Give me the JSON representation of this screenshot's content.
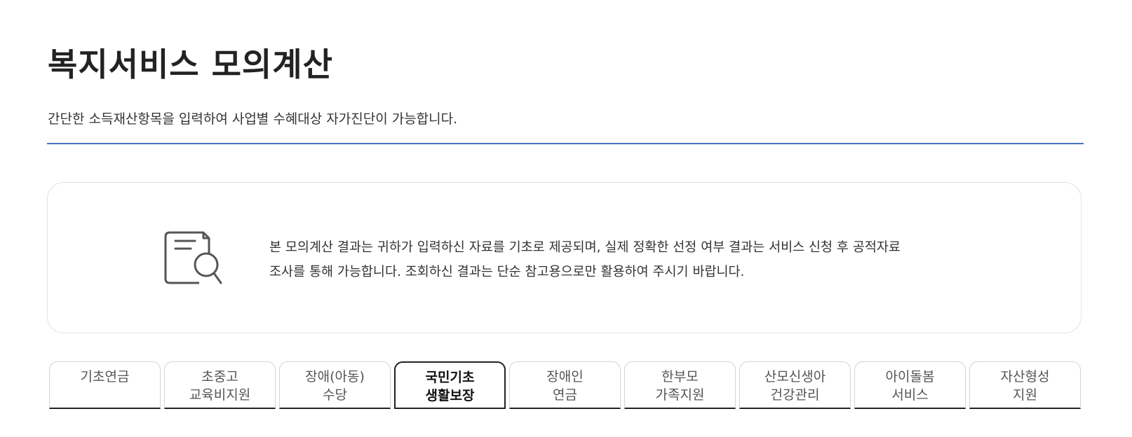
{
  "header": {
    "title": "복지서비스 모의계산",
    "description": "간단한 소득재산항목을 입력하여 사업별 수혜대상 자가진단이 가능합니다."
  },
  "notice": {
    "icon": "document-search-icon",
    "line1": "본 모의계산 결과는 귀하가 입력하신 자료를 기초로 제공되며, 실제 정확한 선정 여부 결과는 서비스 신청 후 공적자료",
    "line2": "조사를 통해 가능합니다. 조회하신 결과는 단순 참고용으로만 활용하여 주시기 바랍니다."
  },
  "colors": {
    "divider": "#4a72c2",
    "active_tab_border": "#222222"
  },
  "tabs": [
    {
      "line1": "기초연금",
      "line2": "",
      "active": false
    },
    {
      "line1": "초중고",
      "line2": "교육비지원",
      "active": false
    },
    {
      "line1": "장애(아동)",
      "line2": "수당",
      "active": false
    },
    {
      "line1": "국민기초",
      "line2": "생활보장",
      "active": true
    },
    {
      "line1": "장애인",
      "line2": "연금",
      "active": false
    },
    {
      "line1": "한부모",
      "line2": "가족지원",
      "active": false
    },
    {
      "line1": "산모신생아",
      "line2": "건강관리",
      "active": false
    },
    {
      "line1": "아이돌봄",
      "line2": "서비스",
      "active": false
    },
    {
      "line1": "자산형성",
      "line2": "지원",
      "active": false
    }
  ]
}
